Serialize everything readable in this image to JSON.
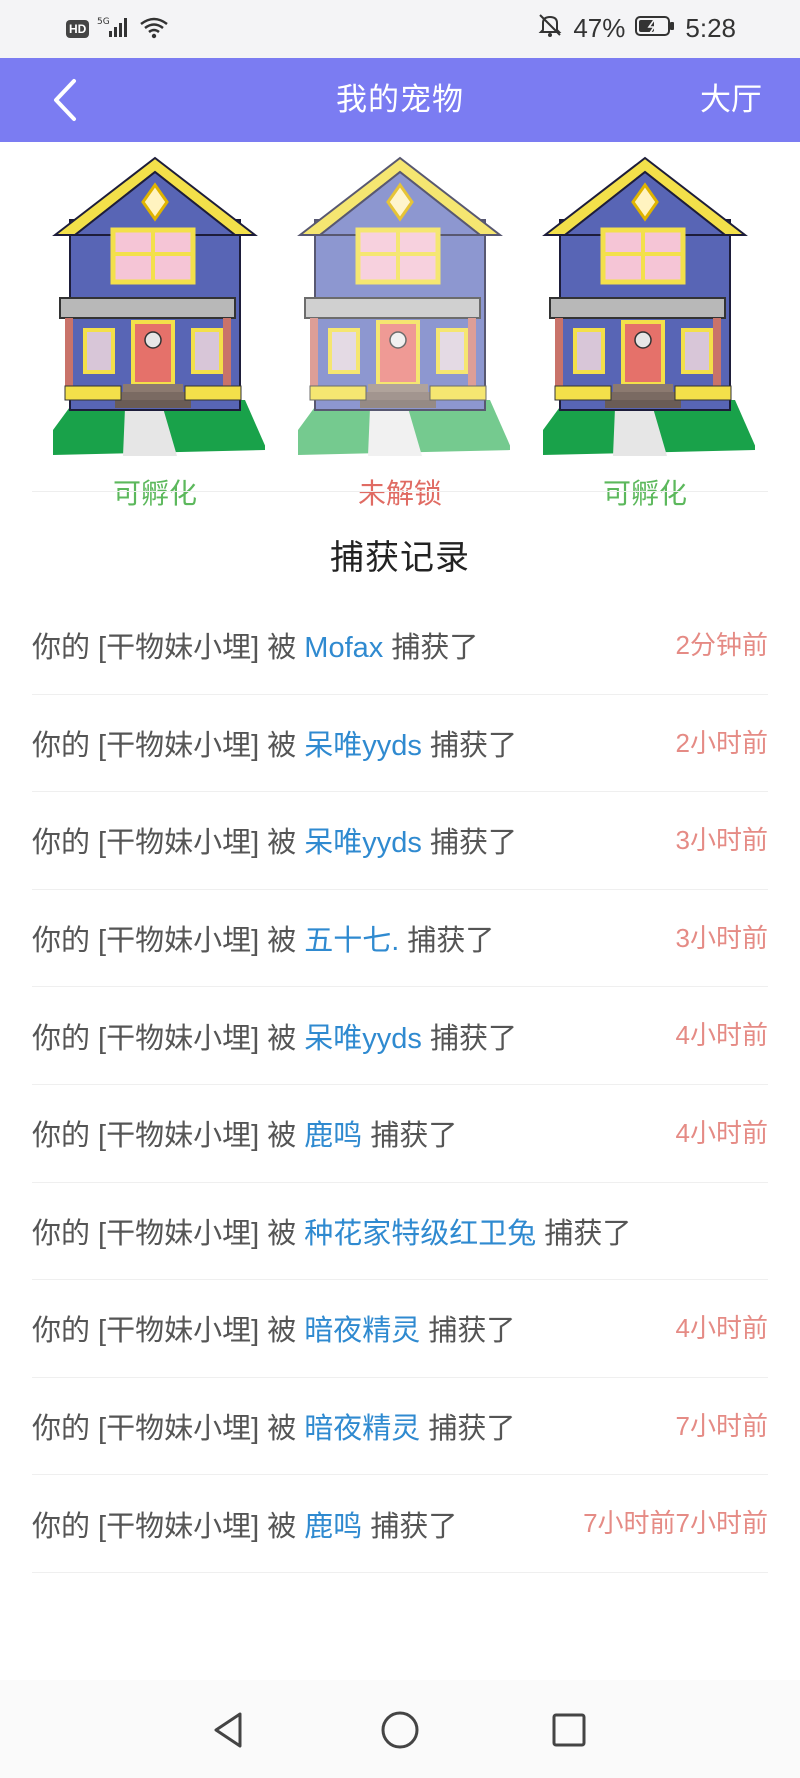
{
  "status_bar": {
    "hd": "HD",
    "network": "5G",
    "battery": "47%",
    "time": "5:28"
  },
  "app_bar": {
    "title": "我的宠物",
    "right_action": "大厅"
  },
  "houses": [
    {
      "status": "可孵化",
      "status_color": "#5cb85c"
    },
    {
      "status": "未解锁",
      "status_color": "#e06b63"
    },
    {
      "status": "可孵化",
      "status_color": "#5cb85c"
    }
  ],
  "section_title": "捕获记录",
  "records": [
    {
      "prefix": "你的 [干物妹小埋] 被 ",
      "catcher": "Mofax",
      "suffix": " 捕获了",
      "time": "2分钟前"
    },
    {
      "prefix": "你的 [干物妹小埋] 被 ",
      "catcher": "呆唯yyds",
      "suffix": " 捕获了",
      "time": "2小时前"
    },
    {
      "prefix": "你的 [干物妹小埋] 被 ",
      "catcher": "呆唯yyds",
      "suffix": " 捕获了",
      "time": "3小时前"
    },
    {
      "prefix": "你的 [干物妹小埋] 被 ",
      "catcher": "五十七.",
      "suffix": " 捕获了",
      "time": "3小时前"
    },
    {
      "prefix": "你的 [干物妹小埋] 被 ",
      "catcher": "呆唯yyds",
      "suffix": " 捕获了",
      "time": "4小时前"
    },
    {
      "prefix": "你的 [干物妹小埋] 被 ",
      "catcher": "鹿鸣",
      "suffix": " 捕获了",
      "time": "4小时前"
    },
    {
      "prefix": "你的 [干物妹小埋] 被 ",
      "catcher": "种花家特级红卫兔",
      "suffix": " 捕获了",
      "time": ""
    },
    {
      "prefix": "你的 [干物妹小埋] 被 ",
      "catcher": "暗夜精灵",
      "suffix": " 捕获了",
      "time": "4小时前"
    },
    {
      "prefix": "你的 [干物妹小埋] 被 ",
      "catcher": "暗夜精灵",
      "suffix": " 捕获了",
      "time": "7小时前"
    },
    {
      "prefix": "你的 [干物妹小埋] 被 ",
      "catcher": "鹿鸣",
      "suffix": " 捕获了",
      "time": "7小时前7小时前"
    }
  ],
  "nav_bar": {
    "buttons": [
      "back-triangle-icon",
      "home-circle-icon",
      "recents-square-icon"
    ]
  },
  "colors": {
    "app_bar": "#7b7cf2",
    "catcher_name": "#2f8ad0",
    "timestamp": "#e58b85"
  }
}
